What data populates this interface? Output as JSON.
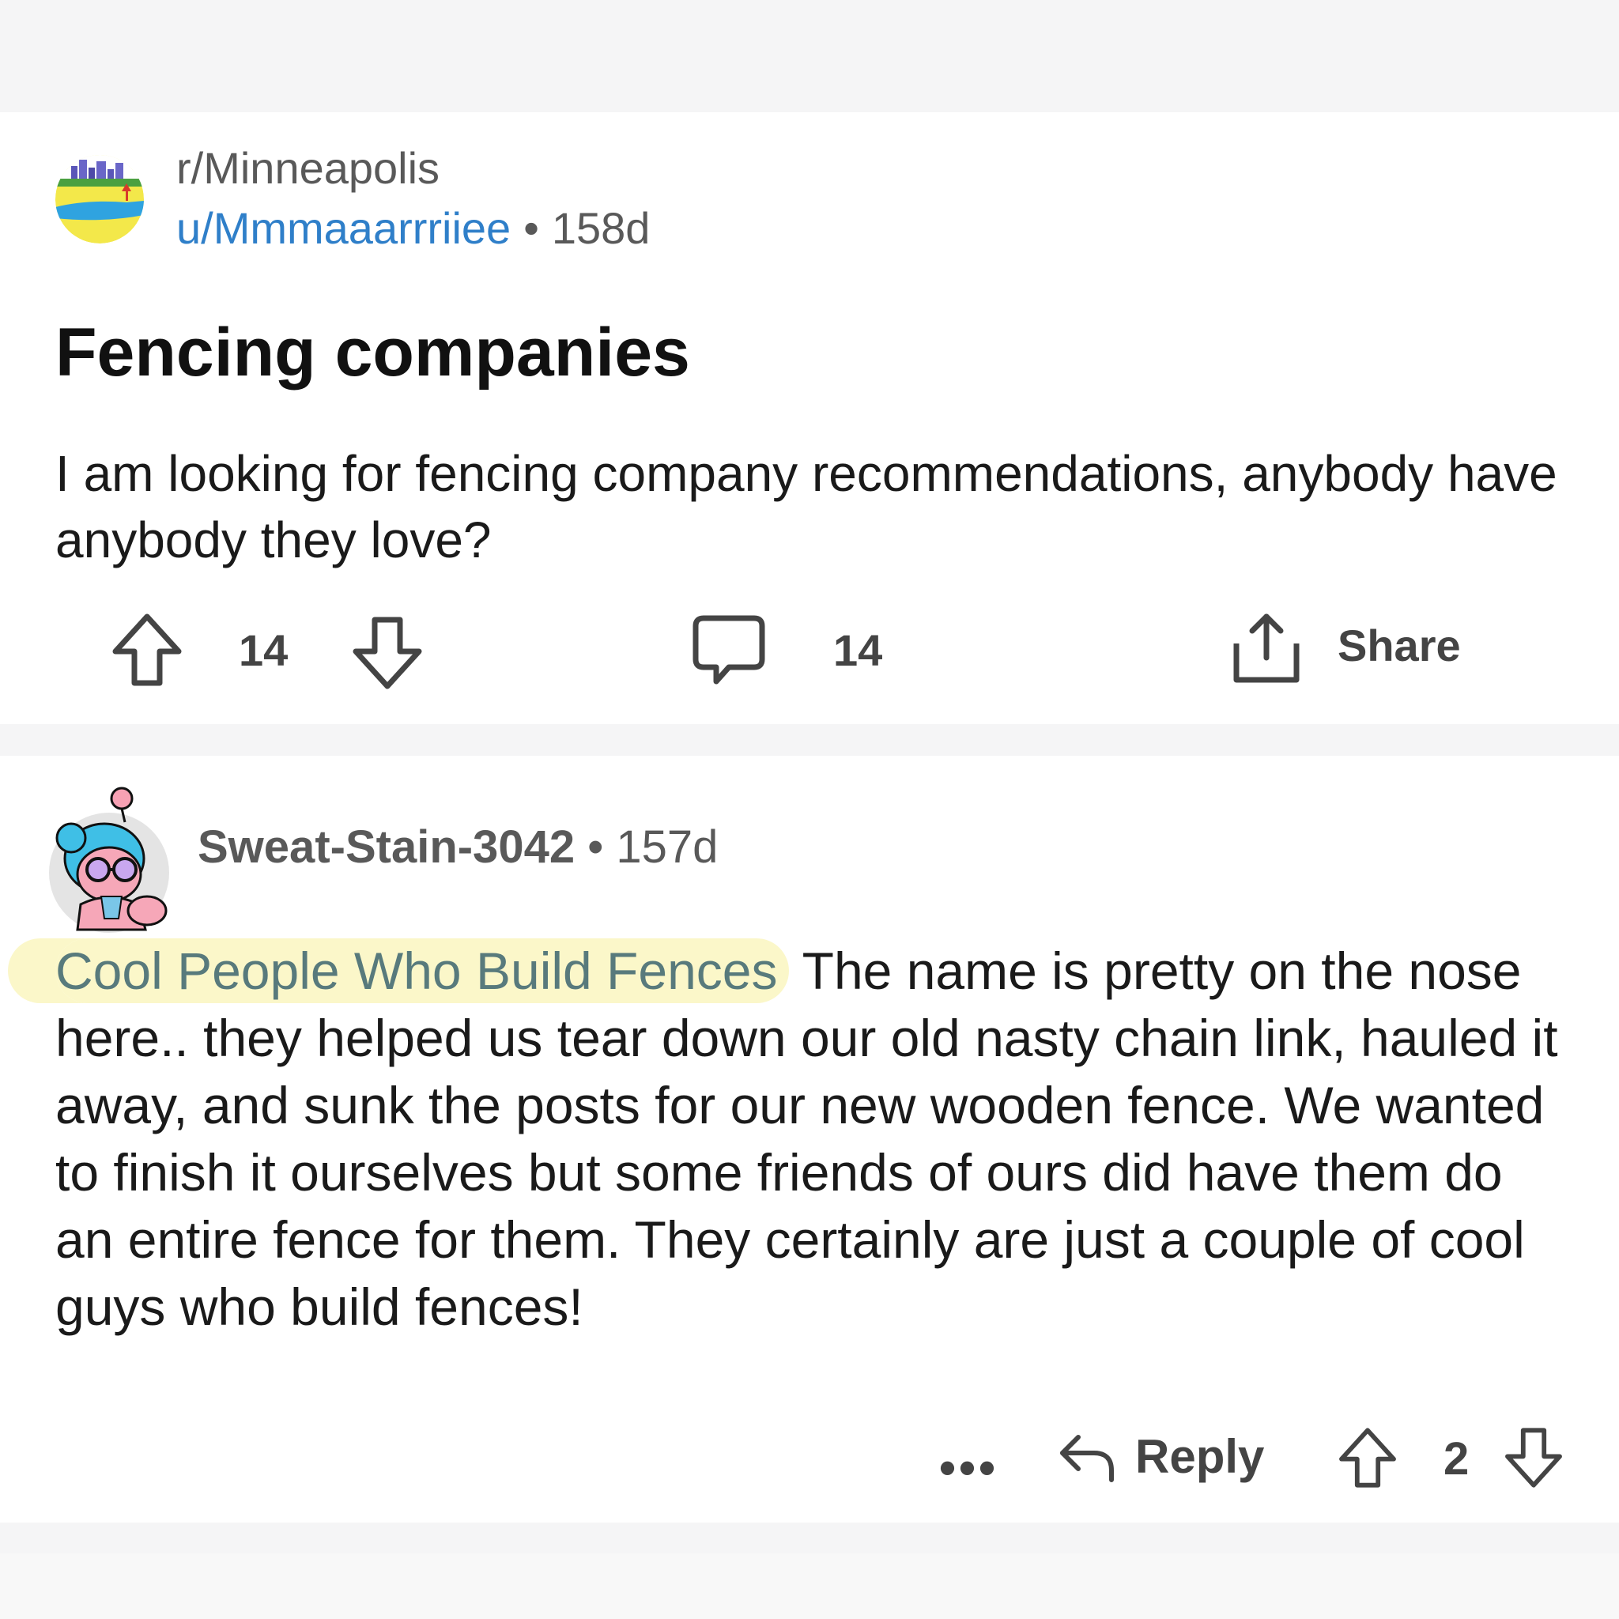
{
  "post": {
    "subreddit": "r/Minneapolis",
    "author": "u/Mmmaaarrriiee",
    "separator": "•",
    "age": "158d",
    "title": "Fencing companies",
    "body": "I am looking for fencing company recommendations, anybody have anybody they love?",
    "upvotes": "14",
    "comments": "14",
    "share_label": "Share"
  },
  "comment": {
    "author": "Sweat-Stain-3042",
    "separator": "•",
    "age": "157d",
    "link_text": "Cool People Who Build Fences",
    "body_text": " The name is pretty on the nose here.. they helped us tear down our old nasty chain link, hauled it away, and sunk the posts for our new wooden fence. We wanted to finish it ourselves but some friends of ours did have them do an entire fence for them. They certainly are just a couple of cool guys who build fences!",
    "more_label": "•••",
    "reply_label": "Reply",
    "votes": "2"
  },
  "colors": {
    "link": "#2f7fc9",
    "highlight": "#fbf7c9",
    "comment_link": "#587a7c",
    "text": "#1a1a1a",
    "muted": "#595959"
  },
  "icons": [
    "subreddit-avatar",
    "upvote-icon",
    "downvote-icon",
    "comment-icon",
    "share-icon",
    "user-avatar",
    "more-icon",
    "reply-icon"
  ]
}
